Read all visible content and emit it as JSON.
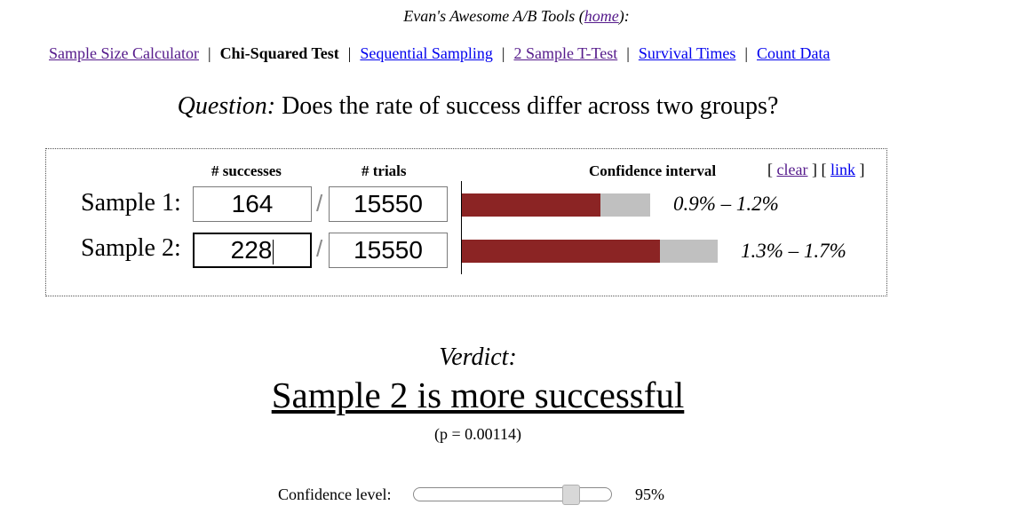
{
  "header": {
    "title_prefix": "Evan's Awesome A/B Tools (",
    "home_link": "home",
    "title_suffix": "):"
  },
  "nav": {
    "separator": "|",
    "items": [
      {
        "label": "Sample Size Calculator",
        "current": false
      },
      {
        "label": "Chi-Squared Test",
        "current": true
      },
      {
        "label": "Sequential Sampling",
        "current": false
      },
      {
        "label": "2 Sample T-Test",
        "current": false
      },
      {
        "label": "Survival Times",
        "current": false
      },
      {
        "label": "Count Data",
        "current": false
      }
    ]
  },
  "question": {
    "label": "Question:",
    "text": " Does the rate of success differ across two groups?"
  },
  "table": {
    "successes_header": "# successes",
    "trials_header": "# trials",
    "ci_header": "Confidence interval",
    "clear_link": "clear",
    "link_link": "link",
    "divider": "/",
    "samples": [
      {
        "label": "Sample 1:",
        "successes": "164",
        "trials": "15550",
        "ci": "0.9% – 1.2%"
      },
      {
        "label": "Sample 2:",
        "successes": "228",
        "trials": "15550",
        "ci": "1.3% – 1.7%"
      }
    ]
  },
  "verdict": {
    "label": "Verdict:",
    "text": "Sample 2 is more successful",
    "p_value": "(p = 0.00114)"
  },
  "confidence": {
    "label": "Confidence level:",
    "value": "95%",
    "slider_fraction": 0.75
  },
  "colors": {
    "bar_fill": "#8b2424",
    "bar_background": "#c0c0c0",
    "link": "#0000ee",
    "visited_link": "#551a8b"
  }
}
